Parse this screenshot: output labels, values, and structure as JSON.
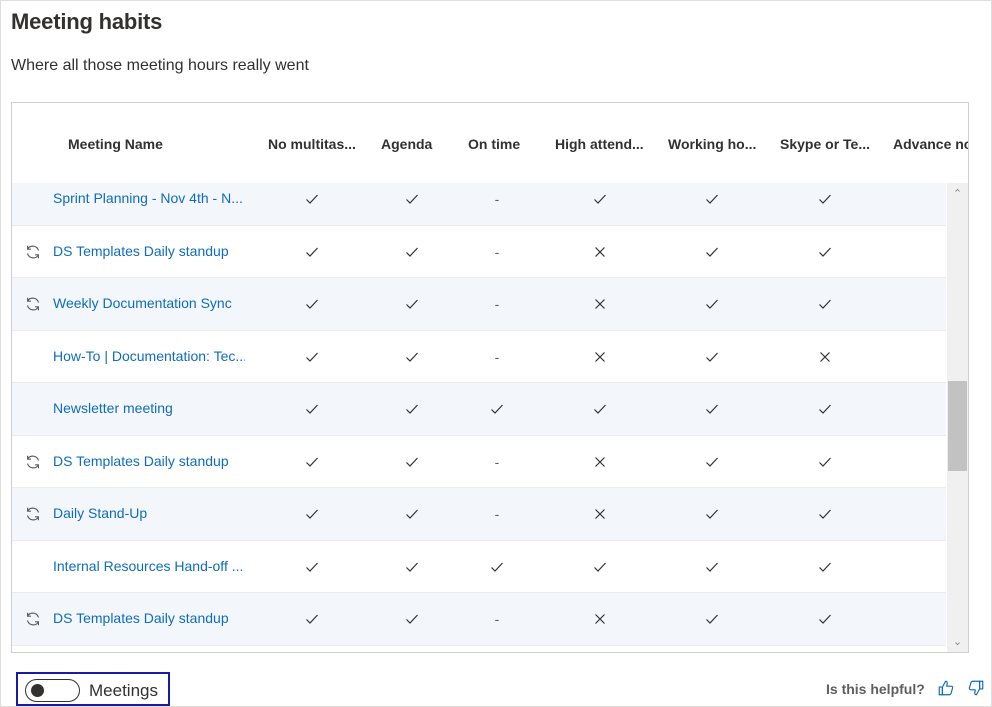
{
  "header": {
    "title": "Meeting habits",
    "subtitle": "Where all those meeting hours really went"
  },
  "grid": {
    "columns": [
      "Meeting Name",
      "No multitas...",
      "Agenda",
      "On time",
      "High attend...",
      "Working ho...",
      "Skype or Te...",
      "Advance no"
    ],
    "rows": [
      {
        "name": "Sprint Planning - Nov 4th - N...",
        "recurring": false,
        "values": [
          "check",
          "check",
          "dash",
          "check",
          "check",
          "check"
        ]
      },
      {
        "name": "DS Templates Daily standup",
        "recurring": true,
        "values": [
          "check",
          "check",
          "dash",
          "cross",
          "check",
          "check"
        ]
      },
      {
        "name": "Weekly Documentation Sync",
        "recurring": true,
        "values": [
          "check",
          "check",
          "dash",
          "cross",
          "check",
          "check"
        ]
      },
      {
        "name": "How-To | Documentation: Tec...",
        "recurring": false,
        "values": [
          "check",
          "check",
          "dash",
          "cross",
          "check",
          "cross"
        ]
      },
      {
        "name": "Newsletter meeting",
        "recurring": false,
        "values": [
          "check",
          "check",
          "check",
          "check",
          "check",
          "check"
        ]
      },
      {
        "name": "DS Templates Daily standup",
        "recurring": true,
        "values": [
          "check",
          "check",
          "dash",
          "cross",
          "check",
          "check"
        ]
      },
      {
        "name": "Daily Stand-Up",
        "recurring": true,
        "values": [
          "check",
          "check",
          "dash",
          "cross",
          "check",
          "check"
        ]
      },
      {
        "name": "Internal Resources Hand-off ...",
        "recurring": false,
        "values": [
          "check",
          "check",
          "check",
          "check",
          "check",
          "check"
        ]
      },
      {
        "name": "DS Templates Daily standup",
        "recurring": true,
        "values": [
          "check",
          "check",
          "dash",
          "cross",
          "check",
          "check"
        ]
      }
    ]
  },
  "footer": {
    "toggle_label": "Meetings",
    "toggle_on": false,
    "helpful_label": "Is this helpful?"
  },
  "icons": {
    "recurring": "recurring-icon",
    "check": "check-icon",
    "cross": "cross-icon",
    "dash": "dash-icon",
    "like": "thumbs-up-icon",
    "dislike": "thumbs-down-icon"
  },
  "colors": {
    "link": "#0f6cbd",
    "alt_row": "#f3f7fb",
    "focus_outline": "#1a1aa6"
  }
}
